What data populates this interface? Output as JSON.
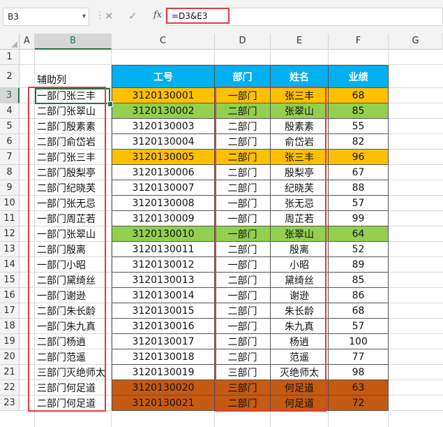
{
  "formula_bar": {
    "name_box": "B3",
    "cancel_icon": "✕",
    "enter_icon": "✓",
    "fx_label": "fx",
    "formula": "=D3&E3"
  },
  "columns": [
    "A",
    "B",
    "C",
    "D",
    "E",
    "F",
    "G"
  ],
  "rows": [
    "1",
    "2",
    "3",
    "4",
    "5",
    "6",
    "7",
    "8",
    "9",
    "10",
    "11",
    "12",
    "13",
    "14",
    "15",
    "16",
    "17",
    "18",
    "19",
    "20",
    "21",
    "22",
    "23"
  ],
  "aux_header": "辅助列",
  "table": {
    "headers": [
      "工号",
      "部门",
      "姓名",
      "业绩"
    ],
    "records": [
      {
        "helper": "一部门张三丰",
        "id": "3120130001",
        "dept": "一部门",
        "name": "张三丰",
        "score": "68",
        "fill": "#ffc000"
      },
      {
        "helper": "二部门张翠山",
        "id": "3120130002",
        "dept": "二部门",
        "name": "张翠山",
        "score": "85",
        "fill": "#92d050"
      },
      {
        "helper": "二部门殷素素",
        "id": "3120130003",
        "dept": "二部门",
        "name": "殷素素",
        "score": "55",
        "fill": ""
      },
      {
        "helper": "二部门俞岱岩",
        "id": "3120130004",
        "dept": "二部门",
        "name": "俞岱岩",
        "score": "82",
        "fill": ""
      },
      {
        "helper": "二部门张三丰",
        "id": "3120130005",
        "dept": "二部门",
        "name": "张三丰",
        "score": "96",
        "fill": "#ffc000"
      },
      {
        "helper": "二部门殷梨亭",
        "id": "3120130006",
        "dept": "二部门",
        "name": "殷梨亭",
        "score": "67",
        "fill": ""
      },
      {
        "helper": "二部门纪晓芙",
        "id": "3120130007",
        "dept": "二部门",
        "name": "纪晓芙",
        "score": "88",
        "fill": ""
      },
      {
        "helper": "一部门张无忌",
        "id": "3120130008",
        "dept": "一部门",
        "name": "张无忌",
        "score": "57",
        "fill": ""
      },
      {
        "helper": "一部门周芷若",
        "id": "3120130009",
        "dept": "一部门",
        "name": "周芷若",
        "score": "99",
        "fill": ""
      },
      {
        "helper": "一部门张翠山",
        "id": "3120130010",
        "dept": "一部门",
        "name": "张翠山",
        "score": "64",
        "fill": "#92d050"
      },
      {
        "helper": "二部门殷离",
        "id": "3120130011",
        "dept": "二部门",
        "name": "殷离",
        "score": "52",
        "fill": ""
      },
      {
        "helper": "一部门小昭",
        "id": "3120130012",
        "dept": "一部门",
        "name": "小昭",
        "score": "89",
        "fill": ""
      },
      {
        "helper": "二部门黛绮丝",
        "id": "3120130013",
        "dept": "二部门",
        "name": "黛绮丝",
        "score": "85",
        "fill": ""
      },
      {
        "helper": "一部门谢逊",
        "id": "3120130014",
        "dept": "一部门",
        "name": "谢逊",
        "score": "86",
        "fill": ""
      },
      {
        "helper": "二部门朱长龄",
        "id": "3120130015",
        "dept": "二部门",
        "name": "朱长龄",
        "score": "68",
        "fill": ""
      },
      {
        "helper": "一部门朱九真",
        "id": "3120130016",
        "dept": "一部门",
        "name": "朱九真",
        "score": "57",
        "fill": ""
      },
      {
        "helper": "二部门杨逍",
        "id": "3120130017",
        "dept": "二部门",
        "name": "杨逍",
        "score": "100",
        "fill": ""
      },
      {
        "helper": "二部门范遥",
        "id": "3120130018",
        "dept": "二部门",
        "name": "范遥",
        "score": "77",
        "fill": ""
      },
      {
        "helper": "三部门灭绝师太",
        "id": "3120130019",
        "dept": "三部门",
        "name": "灭绝师太",
        "score": "98",
        "fill": ""
      },
      {
        "helper": "三部门何足道",
        "id": "3120130020",
        "dept": "三部门",
        "name": "何足道",
        "score": "63",
        "fill": "#c55a11"
      },
      {
        "helper": "二部门何足道",
        "id": "3120130021",
        "dept": "二部门",
        "name": "何足道",
        "score": "72",
        "fill": "#c55a11"
      }
    ]
  },
  "colors": {
    "header_fill": "#00b0f0",
    "highlight_border": "#e23b3b",
    "selection": "#217346"
  }
}
